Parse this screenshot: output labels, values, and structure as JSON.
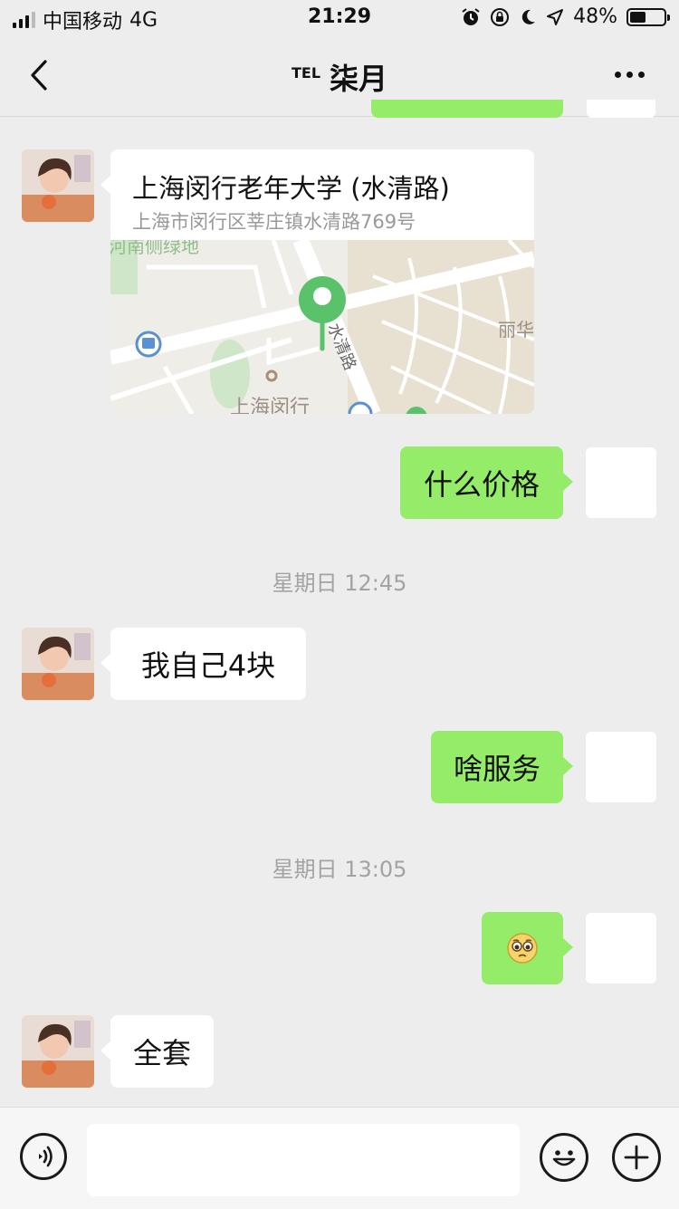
{
  "status_bar": {
    "carrier": "中国移动",
    "network": "4G",
    "time": "21:29",
    "battery_text": "48%",
    "battery_level": 0.48
  },
  "nav": {
    "tel_prefix": "TEL",
    "title": "柒月"
  },
  "location": {
    "title": "上海闵行老年大学 (水清路)",
    "address": "上海市闵行区莘庄镇水清路769号",
    "map_labels": {
      "top": "河南侧绿地",
      "road": "水清路",
      "right": "丽华",
      "bottom": "上海闵行"
    }
  },
  "messages": [
    {
      "side": "out",
      "text": "什么价格"
    },
    {
      "side": "in",
      "text": "我自己4块"
    },
    {
      "side": "out",
      "text": "啥服务"
    },
    {
      "side": "out",
      "emoji": "pleading-face"
    },
    {
      "side": "in",
      "text": "全套"
    }
  ],
  "timestamps": [
    "星期日 12:45",
    "星期日 13:05"
  ],
  "input": {
    "placeholder": ""
  },
  "colors": {
    "background": "#ededed",
    "bubble_out": "#95ec69",
    "bubble_in": "#ffffff",
    "map_pin": "#5ac26a"
  }
}
